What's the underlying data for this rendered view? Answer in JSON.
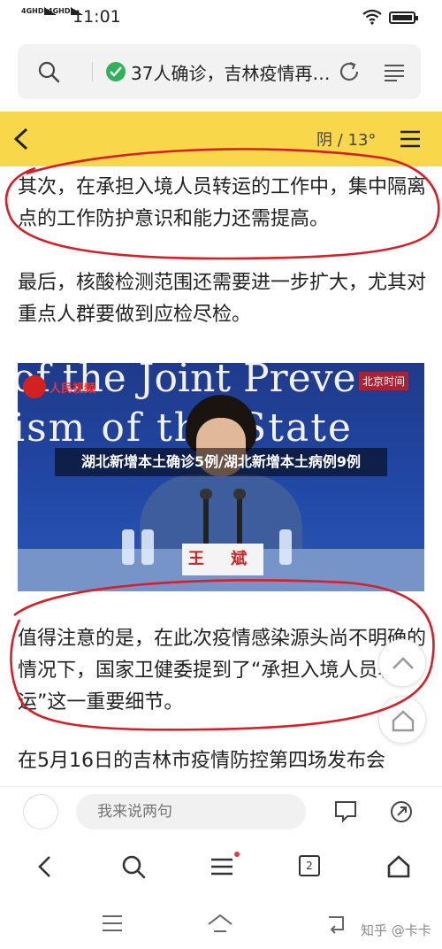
{
  "status_bar": {
    "signal_1": "4GHD",
    "signal_2": "4GHD",
    "time": "11:01"
  },
  "url_bar": {
    "title": "37人确诊，吉林疫情再…",
    "secure_icon": "shield-check-icon",
    "secure_color": "#2eb35a"
  },
  "page_header": {
    "weather": "阴 / 13°",
    "accent_color": "#f8d84a"
  },
  "article": {
    "para_1": "其次，在承担入境人员转运的工作中，集中隔离点的工作防护意识和能力还需提高。",
    "para_2": "最后，核酸检测范围还需要进一步扩大，尤其对重点人群要做到应检尽检。",
    "photo": {
      "banner_line_1": "of the Joint Preve",
      "banner_line_2": "ism of the State",
      "channel": "人民视频",
      "corner_badge": "北京时间",
      "nameplate": "王 斌",
      "caption": "湖北新增本土确诊5例/湖北新增本土病例9例"
    },
    "para_4": "值得注意的是，在此次疫情感染源头尚不明确的情况下，国家卫健委提到了“承担入境人员转运”这一重要细节。",
    "para_5": "在5月16日的吉林市疫情防控第四场发布会"
  },
  "comment_bar": {
    "placeholder": "我来说两句"
  },
  "browser_nav": {
    "tab_count": "2"
  },
  "watermark": "知乎 @卡卡",
  "annotation_color": "#d61f26"
}
